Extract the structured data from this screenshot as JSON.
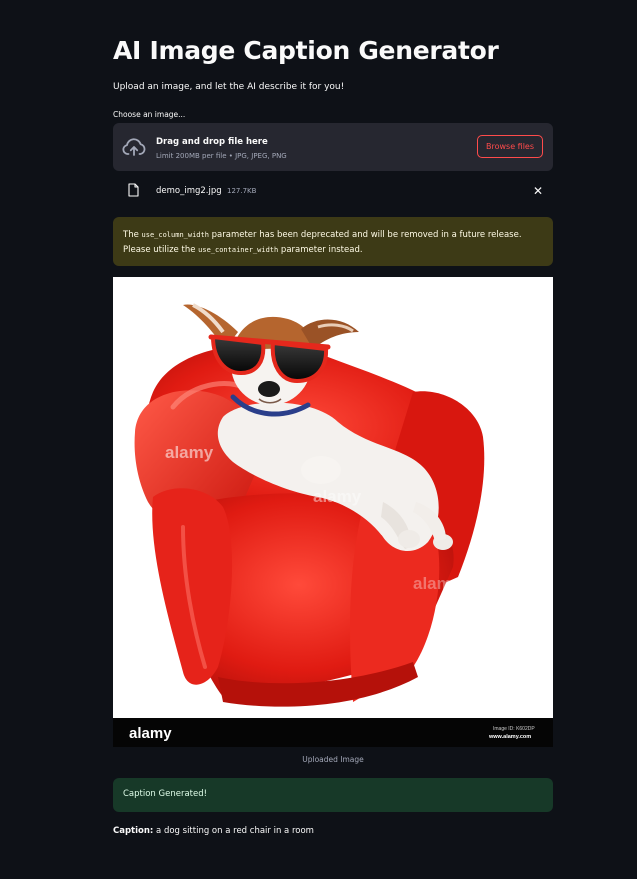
{
  "app": {
    "title": "AI Image Caption Generator",
    "subtitle": "Upload an image, and let the AI describe it for you!"
  },
  "uploader": {
    "label": "Choose an image...",
    "drop_text": "Drag and drop file here",
    "limit_text": "Limit 200MB per file • JPG, JPEG, PNG",
    "browse_label": "Browse files",
    "icon": "cloud-upload-icon"
  },
  "file": {
    "name": "demo_img2.jpg",
    "size": "127.7KB",
    "icon": "file-icon",
    "close_label": "✕"
  },
  "warning": {
    "part1": "The ",
    "code1": "use_column_width",
    "part2": " parameter has been deprecated and will be removed in a future release. Please utilize the ",
    "code2": "use_container_width",
    "part3": " parameter instead."
  },
  "image": {
    "caption": "Uploaded Image",
    "watermark": "alamy",
    "footer_brand": "alamy",
    "footer_id": "Image ID: K602DP",
    "footer_url": "www.alamy.com"
  },
  "success": {
    "message": "Caption Generated!"
  },
  "result": {
    "label": "Caption:",
    "text": " a dog sitting on a red chair in a room"
  },
  "colors": {
    "background": "#0e1117",
    "accent": "#ff4b4b",
    "warning_bg": "#3d3a16",
    "success_bg": "#173928"
  }
}
